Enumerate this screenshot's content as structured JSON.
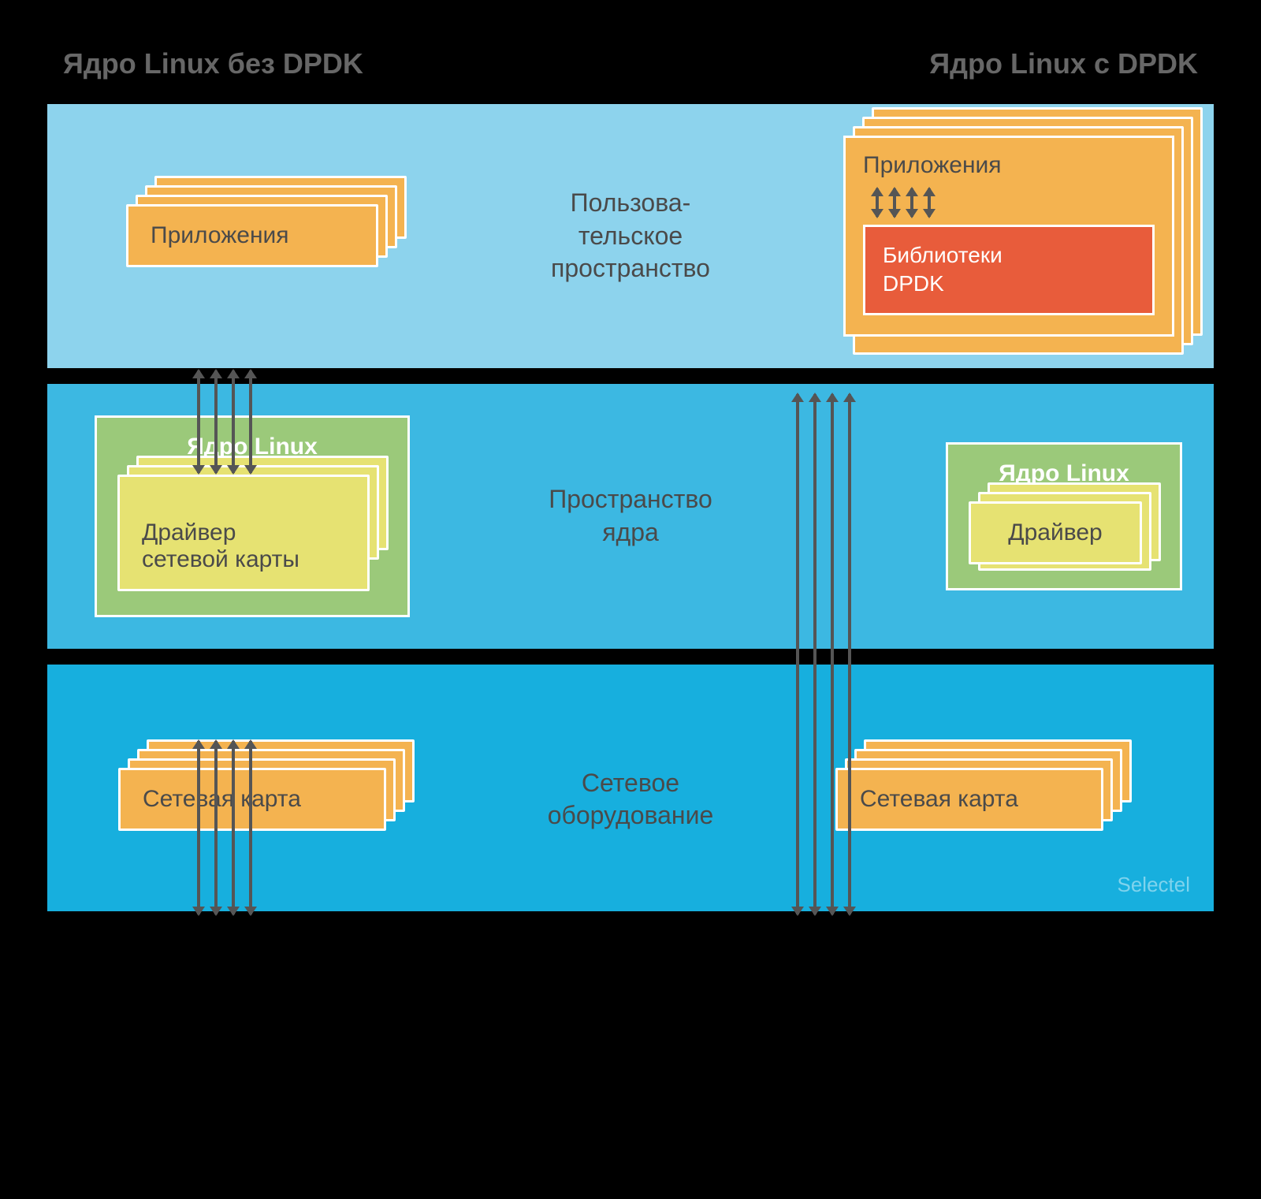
{
  "titles": {
    "left": "Ядро Linux без DPDK",
    "right": "Ядро Linux с DPDK"
  },
  "layers": {
    "userspace": {
      "label": "Пользова-\nтельское\nпространство",
      "left_app": "Приложения",
      "right_app_title": "Приложения",
      "right_dpdk": "Библиотеки\nDPDK"
    },
    "kernelspace": {
      "label": "Пространство\nядра",
      "left_kernel_title": "Ядро Linux",
      "left_driver": "Драйвер\nсетевой карты",
      "right_kernel_title": "Ядро Linux",
      "right_driver": "Драйвер"
    },
    "hardware": {
      "label": "Сетевое\nоборудование",
      "left_nic": "Сетевая карта",
      "right_nic": "Сетевая карта"
    }
  },
  "watermark": "Selectel",
  "colors": {
    "orange": "#f4b350",
    "green": "#9bc97a",
    "yellow": "#e6e272",
    "red": "#e85c3b",
    "layer1": "#8dd3ed",
    "layer2": "#3cb8e2",
    "layer3": "#17afde",
    "arrow": "#555555"
  }
}
